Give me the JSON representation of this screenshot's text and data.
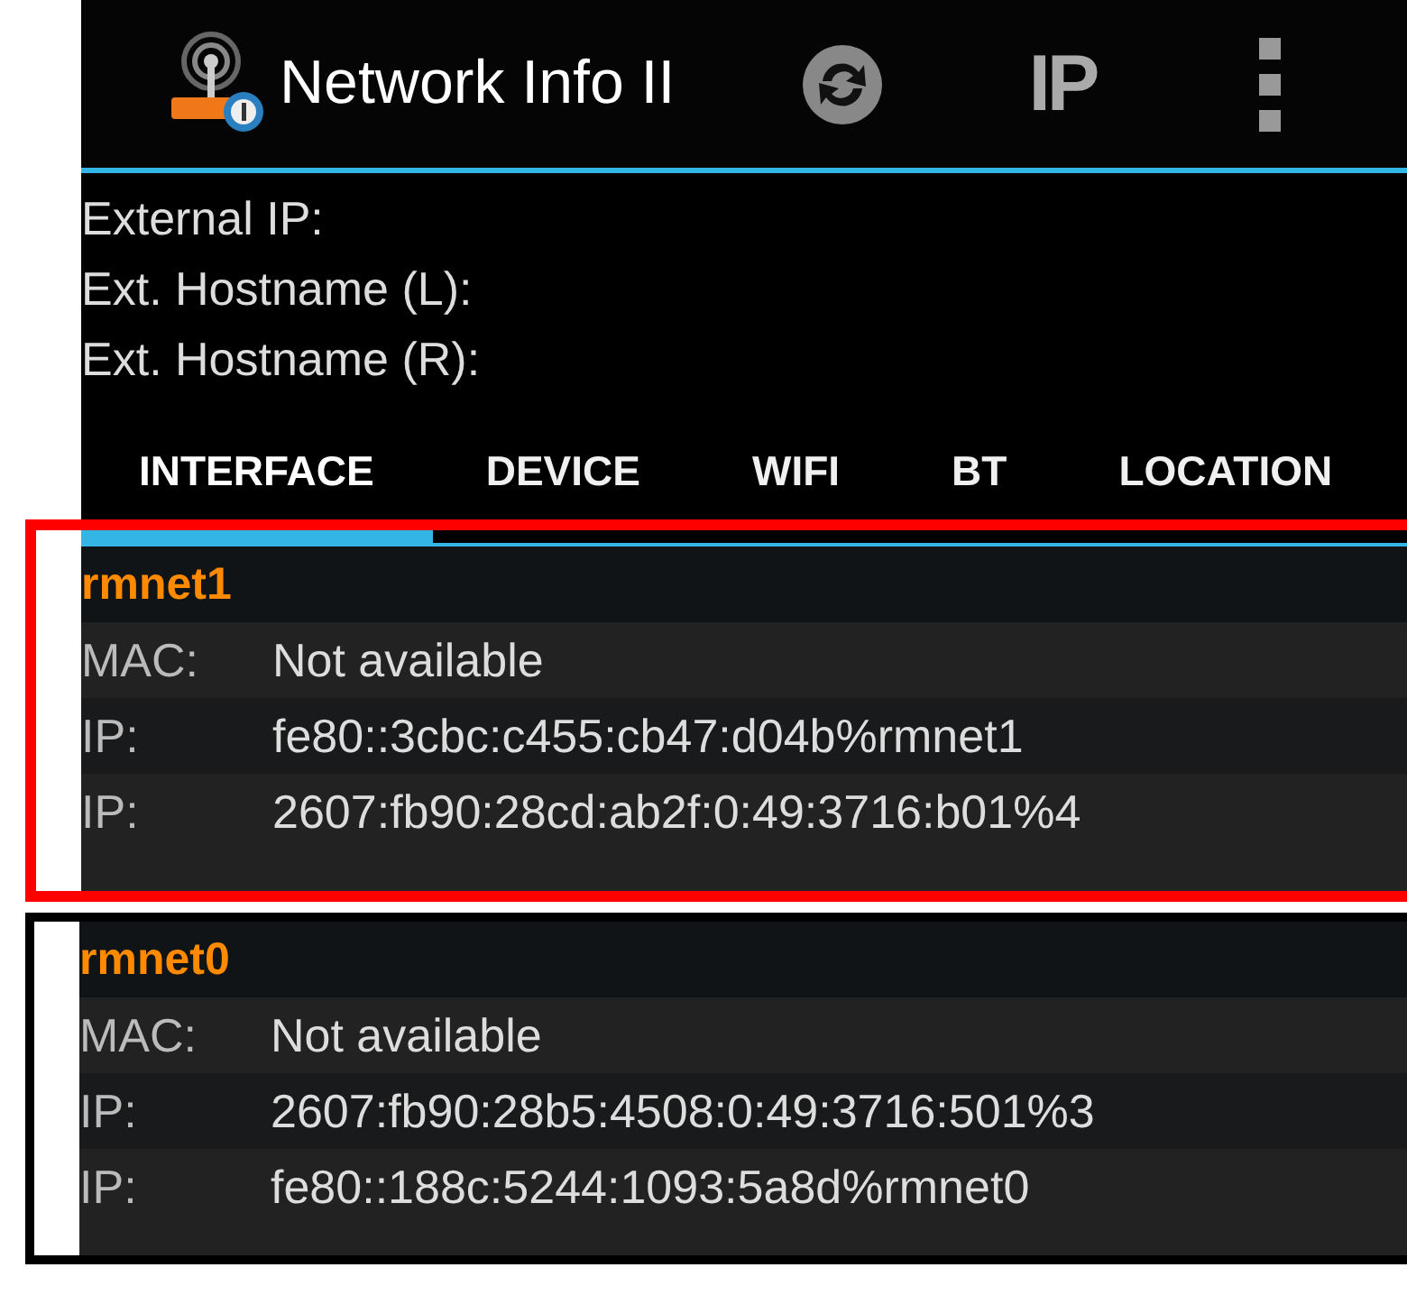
{
  "action_bar": {
    "title": "Network Info II",
    "ip_button": "IP"
  },
  "info": [
    {
      "label": "External IP:"
    },
    {
      "label": "Ext. Hostname (L):"
    },
    {
      "label": "Ext. Hostname (R):"
    }
  ],
  "tabs": [
    {
      "label": "INTERFACE",
      "selected": true
    },
    {
      "label": "DEVICE",
      "selected": false
    },
    {
      "label": "WIFI",
      "selected": false
    },
    {
      "label": "BT",
      "selected": false
    },
    {
      "label": "LOCATION",
      "selected": false
    }
  ],
  "interfaces": [
    {
      "name": "rmnet1",
      "color": "#ff0000",
      "rows": [
        {
          "label": "MAC:",
          "value": "Not available"
        },
        {
          "label": "IP:",
          "value": "fe80::3cbc:c455:cb47:d04b%rmnet1"
        },
        {
          "label": "IP:",
          "value": "2607:fb90:28cd:ab2f:0:49:3716:b01%4"
        }
      ]
    },
    {
      "name": "rmnet0",
      "color": "#000000",
      "rows": [
        {
          "label": "MAC:",
          "value": "Not available"
        },
        {
          "label": "IP:",
          "value": "2607:fb90:28b5:4508:0:49:3716:501%3"
        },
        {
          "label": "IP:",
          "value": "fe80::188c:5244:1093:5a8d%rmnet0"
        }
      ]
    }
  ]
}
